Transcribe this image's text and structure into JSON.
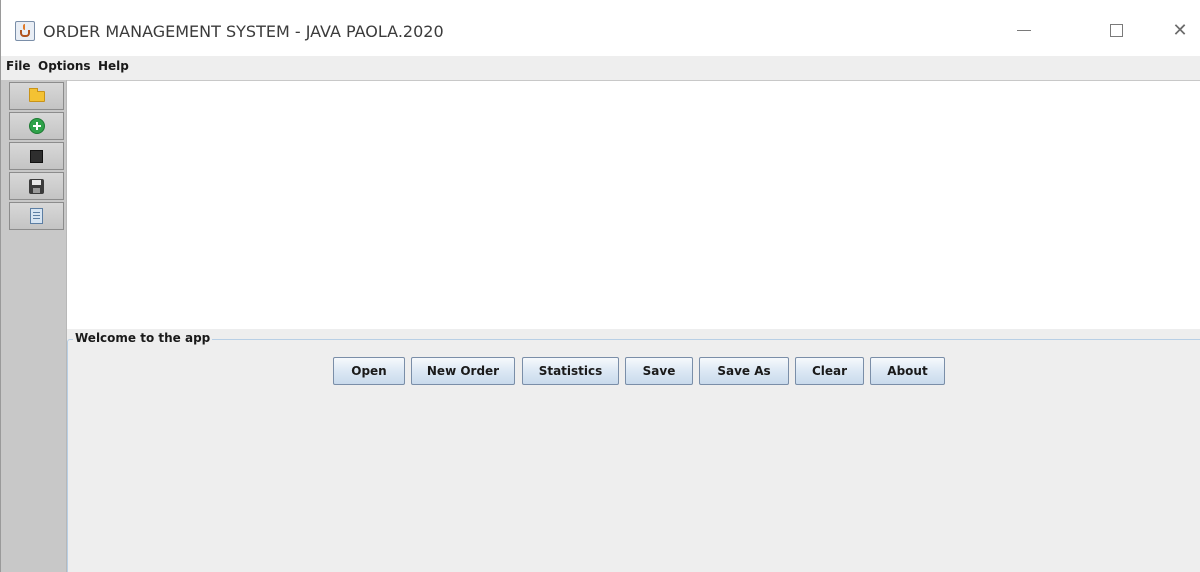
{
  "window": {
    "title": "ORDER MANAGEMENT SYSTEM - JAVA PAOLA.2020",
    "controls": [
      "minimize",
      "maximize",
      "close"
    ],
    "close_glyph": "✕"
  },
  "menu": {
    "file": "File",
    "options": "Options",
    "help": "Help"
  },
  "toolbar": {
    "buttons": [
      {
        "icon": "folder-icon",
        "action": "open"
      },
      {
        "icon": "add-icon",
        "action": "new-order"
      },
      {
        "icon": "chip-icon",
        "action": "statistics"
      },
      {
        "icon": "floppy-disk-icon",
        "action": "save"
      },
      {
        "icon": "document-icon",
        "action": "save-as"
      }
    ]
  },
  "panel": {
    "title": "Welcome to the app",
    "buttons": {
      "open": "Open",
      "new_order": "New Order",
      "statistics": "Statistics",
      "save": "Save",
      "save_as": "Save As",
      "clear": "Clear",
      "about": "About"
    }
  },
  "colors": {
    "toolbar_bg": "#c8c8c8",
    "panel_bg": "#eeeeee",
    "button_border": "#7a8ea8",
    "group_border": "#b8cfe5"
  }
}
